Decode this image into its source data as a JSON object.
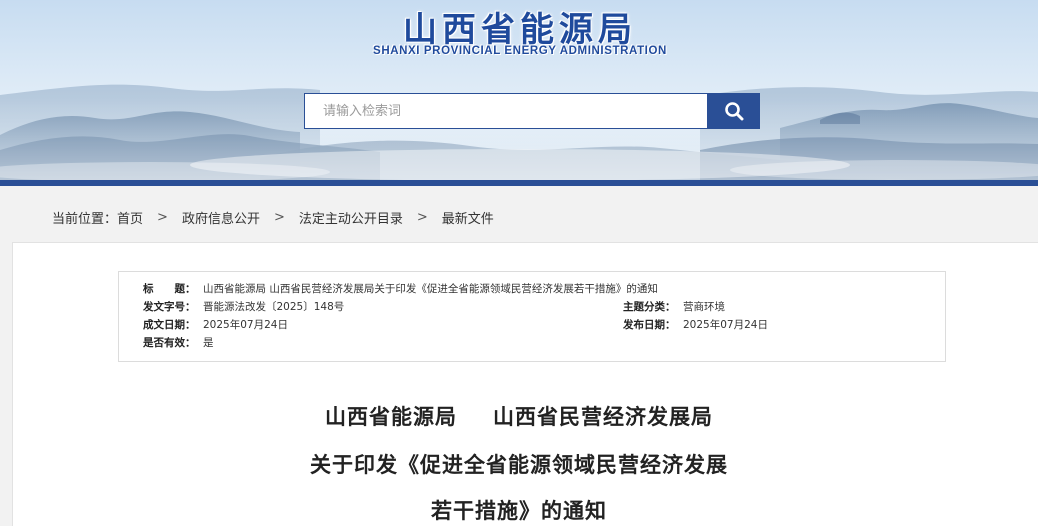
{
  "header": {
    "logo_cn": "山西省能源局",
    "logo_en": "SHANXI PROVINCIAL ENERGY ADMINISTRATION",
    "search_placeholder": "请输入检索词",
    "search_icon": "search-icon",
    "brand_color": "#2a4f96"
  },
  "breadcrumb": {
    "label": "当前位置：",
    "items": [
      "首页",
      "政府信息公开",
      "法定主动公开目录",
      "最新文件"
    ],
    "separator": ">"
  },
  "meta": {
    "title_label": "标　　题：",
    "title_value": "山西省能源局 山西省民营经济发展局关于印发《促进全省能源领域民营经济发展若干措施》的通知",
    "doc_no_label": "发文字号：",
    "doc_no_value": "晋能源法改发〔2025〕148号",
    "category_label": "主题分类：",
    "category_value": "营商环境",
    "created_label": "成文日期：",
    "created_value": "2025年07月24日",
    "published_label": "发布日期：",
    "published_value": "2025年07月24日",
    "valid_label": "是否有效：",
    "valid_value": "是"
  },
  "article": {
    "title_line1_a": "山西省能源局",
    "title_line1_b": "山西省民营经济发展局",
    "title_line2": "关于印发《促进全省能源领域民营经济发展",
    "title_line3": "若干措施》的通知"
  }
}
